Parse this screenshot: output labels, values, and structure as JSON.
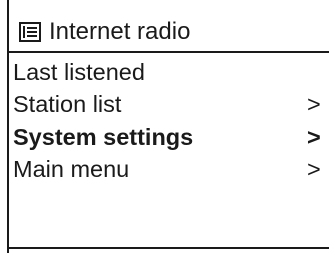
{
  "header": {
    "icon": "list-icon",
    "title": "Internet radio"
  },
  "menu": {
    "items": [
      {
        "label": "Last listened",
        "arrow": "",
        "selected": false
      },
      {
        "label": "Station list",
        "arrow": ">",
        "selected": false
      },
      {
        "label": "System settings",
        "arrow": ">",
        "selected": true
      },
      {
        "label": "Main menu",
        "arrow": ">",
        "selected": false
      }
    ]
  },
  "colors": {
    "foreground": "#1a1a1a",
    "background": "#ffffff"
  }
}
